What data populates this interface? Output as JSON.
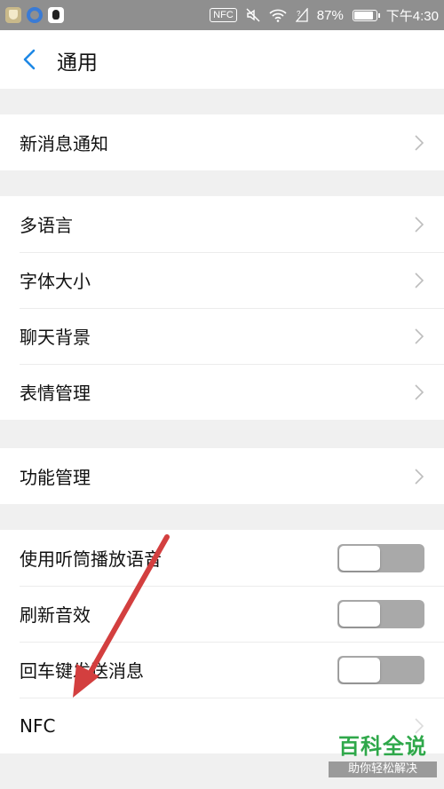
{
  "status_bar": {
    "nfc_label": "NFC",
    "battery_text": "87%",
    "battery_level": 0.87,
    "time": "下午4:30",
    "apps": [
      "shield-app-icon",
      "baidu-app-icon",
      "qq-app-icon"
    ]
  },
  "header": {
    "title": "通用",
    "back_icon": "chevron-left-icon"
  },
  "sections": {
    "notifications": {
      "items": [
        "新消息通知"
      ]
    },
    "display": {
      "items": [
        "多语言",
        "字体大小",
        "聊天背景",
        "表情管理"
      ]
    },
    "features": {
      "items": [
        "功能管理"
      ]
    },
    "toggles": {
      "items": [
        {
          "label": "使用听筒播放语音",
          "on": false
        },
        {
          "label": "刷新音效",
          "on": false
        },
        {
          "label": "回车键发送消息",
          "on": false
        }
      ],
      "nfc_label": "NFC"
    }
  },
  "watermark": {
    "title": "百科全说",
    "subtitle": "助你轻松解决"
  },
  "colors": {
    "accent": "#1e88e5",
    "status_bar": "#8f8f8f",
    "toggle_off": "#a9a9a9",
    "arrow": "#d33f3f",
    "watermark_green": "#2fa84a"
  }
}
